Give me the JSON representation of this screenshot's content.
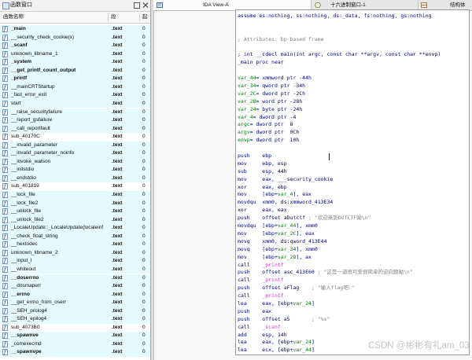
{
  "functions_window": {
    "title": "函数窗口",
    "columns": {
      "name": "函数名称",
      "segment": "段",
      "start": "起"
    },
    "functions": [
      {
        "name": "_main",
        "segment": ".text",
        "start": "0",
        "bold": true,
        "library": true
      },
      {
        "name": "__security_check_cookie(x)",
        "segment": ".text",
        "start": "0",
        "bold": false,
        "library": true
      },
      {
        "name": "_scanf",
        "segment": ".text",
        "start": "0",
        "bold": true,
        "library": true
      },
      {
        "name": "unknown_libname_1",
        "segment": ".text",
        "start": "0",
        "bold": false,
        "library": true
      },
      {
        "name": "_system",
        "segment": ".text",
        "start": "0",
        "bold": true,
        "library": true
      },
      {
        "name": "__get_printf_count_output",
        "segment": ".text",
        "start": "0",
        "bold": true,
        "library": true
      },
      {
        "name": "_printf",
        "segment": ".text",
        "start": "0",
        "bold": true,
        "library": true
      },
      {
        "name": "__mainCRTStartup",
        "segment": ".text",
        "start": "0",
        "bold": false,
        "library": true
      },
      {
        "name": "_fast_error_exit",
        "segment": ".text",
        "start": "0",
        "bold": false,
        "library": true
      },
      {
        "name": "start",
        "segment": ".text",
        "start": "0",
        "bold": false,
        "library": true
      },
      {
        "name": "__raise_securityfailure",
        "segment": ".text",
        "start": "0",
        "bold": false,
        "library": true
      },
      {
        "name": "__report_gsfailure",
        "segment": ".text",
        "start": "0",
        "bold": false,
        "library": true
      },
      {
        "name": "__call_reportfault",
        "segment": ".text",
        "start": "0",
        "bold": false,
        "library": true
      },
      {
        "name": "sub_40170C",
        "segment": ".text",
        "start": "0",
        "bold": false,
        "library": false
      },
      {
        "name": "__invalid_parameter",
        "segment": ".text",
        "start": "0",
        "bold": false,
        "library": true
      },
      {
        "name": "__invalid_parameter_noinfo",
        "segment": ".text",
        "start": "0",
        "bold": false,
        "library": true
      },
      {
        "name": "__invoke_watson",
        "segment": ".text",
        "start": "0",
        "bold": false,
        "library": true
      },
      {
        "name": "__initstdio",
        "segment": ".text",
        "start": "0",
        "bold": false,
        "library": true
      },
      {
        "name": "__endstdio",
        "segment": ".text",
        "start": "0",
        "bold": false,
        "library": true
      },
      {
        "name": "sub_401819",
        "segment": ".text",
        "start": "0",
        "bold": false,
        "library": false
      },
      {
        "name": "__lock_file",
        "segment": ".text",
        "start": "0",
        "bold": false,
        "library": true
      },
      {
        "name": "__lock_file2",
        "segment": ".text",
        "start": "0",
        "bold": false,
        "library": true
      },
      {
        "name": "__unlock_file",
        "segment": ".text",
        "start": "0",
        "bold": false,
        "library": true
      },
      {
        "name": "__unlock_file2",
        "segment": ".text",
        "start": "0",
        "bold": false,
        "library": true
      },
      {
        "name": "_LocaleUpdate::_LocaleUpdate(localeinf",
        "segment": ".text",
        "start": "0",
        "bold": false,
        "library": true
      },
      {
        "name": "__check_float_string",
        "segment": ".text",
        "start": "0",
        "bold": false,
        "library": true
      },
      {
        "name": "__hextodec",
        "segment": ".text",
        "start": "0",
        "bold": false,
        "library": true
      },
      {
        "name": "unknown_libname_2",
        "segment": ".text",
        "start": "0",
        "bold": false,
        "library": true
      },
      {
        "name": "__input_l",
        "segment": ".text",
        "start": "0",
        "bold": false,
        "library": true
      },
      {
        "name": "__whiteout",
        "segment": ".text",
        "start": "0",
        "bold": false,
        "library": true
      },
      {
        "name": "__doserrno",
        "segment": ".text",
        "start": "0",
        "bold": true,
        "library": true
      },
      {
        "name": "__dosmaperr",
        "segment": ".text",
        "start": "0",
        "bold": false,
        "library": true
      },
      {
        "name": "__errno",
        "segment": ".text",
        "start": "0",
        "bold": true,
        "library": true
      },
      {
        "name": "__get_errno_from_oserr",
        "segment": ".text",
        "start": "0",
        "bold": false,
        "library": true
      },
      {
        "name": "__SEH_prolog4",
        "segment": ".text",
        "start": "0",
        "bold": false,
        "library": true
      },
      {
        "name": "__SEH_epilog4",
        "segment": ".text",
        "start": "0",
        "bold": false,
        "library": true
      },
      {
        "name": "sub_4073B0",
        "segment": ".text",
        "start": "0",
        "bold": false,
        "library": false
      },
      {
        "name": "__spawnve",
        "segment": ".text",
        "start": "0",
        "bold": true,
        "library": true
      },
      {
        "name": "_comexecmd",
        "segment": ".text",
        "start": "0",
        "bold": false,
        "library": true
      },
      {
        "name": "__spawnvpe",
        "segment": ".text",
        "start": "0",
        "bold": true,
        "library": true
      }
    ]
  },
  "tabs": [
    {
      "label": "IDA View-A",
      "icon": "ida-view-icon",
      "active": true
    },
    {
      "label": "十六进制窗口-1",
      "icon": "hex-view-icon",
      "active": false
    },
    {
      "label": "结构体",
      "icon": "structures-icon",
      "active": false
    }
  ],
  "disassembly": {
    "lines": [
      [
        {
          "text": "assume es:nothing, ss:nothing, ds:_data, fs:nothing, gs:nothing",
          "kind": "ins"
        }
      ],
      [],
      [],
      [
        {
          "text": "; Attributes: bp-based frame",
          "kind": "cmt"
        }
      ],
      [],
      [
        {
          "text": "; int __cdecl main(int argc, const char **argv, const char **envp)",
          "kind": "ins"
        }
      ],
      [
        {
          "text": "_main proc near",
          "kind": "ins"
        }
      ],
      [],
      [
        {
          "text": "var_44",
          "kind": "var"
        },
        {
          "text": "= xmmword ptr -44h",
          "kind": "ins"
        }
      ],
      [
        {
          "text": "var_34",
          "kind": "var"
        },
        {
          "text": "= qword ptr -34h",
          "kind": "ins"
        }
      ],
      [
        {
          "text": "var_2C",
          "kind": "var"
        },
        {
          "text": "= dword ptr -2Ch",
          "kind": "ins"
        }
      ],
      [
        {
          "text": "var_28",
          "kind": "var"
        },
        {
          "text": "= word ptr -28h",
          "kind": "ins"
        }
      ],
      [
        {
          "text": "var_24",
          "kind": "var"
        },
        {
          "text": "= byte ptr -24h",
          "kind": "ins"
        }
      ],
      [
        {
          "text": "var_4",
          "kind": "var"
        },
        {
          "text": "= dword ptr -4",
          "kind": "ins"
        }
      ],
      [
        {
          "text": "argc",
          "kind": "var"
        },
        {
          "text": "= dword ptr  8",
          "kind": "ins"
        }
      ],
      [
        {
          "text": "argv",
          "kind": "var"
        },
        {
          "text": "= dword ptr  0Ch",
          "kind": "ins"
        }
      ],
      [
        {
          "text": "envp",
          "kind": "var"
        },
        {
          "text": "= dword ptr  10h",
          "kind": "ins"
        }
      ],
      [],
      [
        {
          "text": "push    ebp",
          "kind": "ins"
        }
      ],
      [
        {
          "text": "mov     ebp, esp",
          "kind": "ins"
        }
      ],
      [
        {
          "text": "sub     esp, 44h",
          "kind": "ins"
        }
      ],
      [
        {
          "text": "mov     eax, ",
          "kind": "ins"
        },
        {
          "text": "___security_cookie",
          "kind": "name"
        }
      ],
      [
        {
          "text": "xor     eax, ebp",
          "kind": "ins"
        }
      ],
      [
        {
          "text": "mov     [ebp+",
          "kind": "ins"
        },
        {
          "text": "var_4",
          "kind": "var"
        },
        {
          "text": "], eax",
          "kind": "ins"
        }
      ],
      [
        {
          "text": "movdqu  xmm0, ds:xmmword_413E34",
          "kind": "ins"
        }
      ],
      [
        {
          "text": "xor     eax, eax",
          "kind": "ins"
        }
      ],
      [
        {
          "text": "push    offset aDutctf ",
          "kind": "ins"
        },
        {
          "text": "; \"欢迎来到DUTCTF呦\\n\"",
          "kind": "cmt"
        }
      ],
      [
        {
          "text": "movdqu  [ebp+",
          "kind": "ins"
        },
        {
          "text": "var_44",
          "kind": "var"
        },
        {
          "text": "], xmm0",
          "kind": "ins"
        }
      ],
      [
        {
          "text": "mov     [ebp+",
          "kind": "ins"
        },
        {
          "text": "var_2C",
          "kind": "var"
        },
        {
          "text": "], eax",
          "kind": "ins"
        }
      ],
      [
        {
          "text": "movq    xmm0, ds:qword_413E44",
          "kind": "ins"
        }
      ],
      [
        {
          "text": "movq    [ebp+",
          "kind": "ins"
        },
        {
          "text": "var_34",
          "kind": "var"
        },
        {
          "text": "], xmm0",
          "kind": "ins"
        }
      ],
      [
        {
          "text": "mov     [ebp+",
          "kind": "ins"
        },
        {
          "text": "var_28",
          "kind": "var"
        },
        {
          "text": "], ax",
          "kind": "ins"
        }
      ],
      [
        {
          "text": "call    ",
          "kind": "ins"
        },
        {
          "text": "_printf",
          "kind": "lib"
        }
      ],
      [
        {
          "text": "push    offset asc_413E60 ",
          "kind": "ins"
        },
        {
          "text": "; \"这是一道很可爱很简单的逆向题呦\\n\"",
          "kind": "cmt"
        }
      ],
      [
        {
          "text": "call    ",
          "kind": "ins"
        },
        {
          "text": "_printf",
          "kind": "lib"
        }
      ],
      [
        {
          "text": "push    offset aFlag    ",
          "kind": "ins"
        },
        {
          "text": "; \"输入flag吧:\"",
          "kind": "cmt"
        }
      ],
      [
        {
          "text": "call    ",
          "kind": "ins"
        },
        {
          "text": "_printf",
          "kind": "lib"
        }
      ],
      [
        {
          "text": "lea     eax, [ebp+",
          "kind": "ins"
        },
        {
          "text": "var_24",
          "kind": "var"
        },
        {
          "text": "]",
          "kind": "ins"
        }
      ],
      [
        {
          "text": "push    eax",
          "kind": "ins"
        }
      ],
      [
        {
          "text": "push    offset aS       ",
          "kind": "ins"
        },
        {
          "text": "; \"%s\"",
          "kind": "cmt"
        }
      ],
      [
        {
          "text": "call    ",
          "kind": "ins"
        },
        {
          "text": "_scanf",
          "kind": "lib"
        }
      ],
      [
        {
          "text": "add     esp, 14h",
          "kind": "ins"
        }
      ],
      [
        {
          "text": "lea     eax, [ebp+",
          "kind": "ins"
        },
        {
          "text": "var_24",
          "kind": "var"
        },
        {
          "text": "]",
          "kind": "ins"
        }
      ],
      [
        {
          "text": "lea     ecx, [ebp+",
          "kind": "ins"
        },
        {
          "text": "var_44",
          "kind": "var"
        },
        {
          "text": "]",
          "kind": "ins"
        }
      ]
    ]
  },
  "watermark": "CSDN @彬彬有礼am_03",
  "colors": {
    "library_row": "#e4fafe",
    "instruction": "#000080",
    "comment": "#808080",
    "stack_var": "#008000",
    "library_name": "#d633d6"
  }
}
